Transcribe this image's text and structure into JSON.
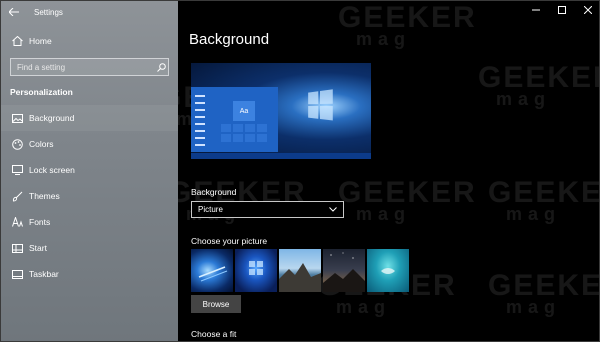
{
  "window": {
    "title": "Settings",
    "controls": [
      "minimize",
      "maximize",
      "close"
    ]
  },
  "sidebar": {
    "home_label": "Home",
    "search": {
      "placeholder": "Find a setting"
    },
    "section_title": "Personalization",
    "items": [
      {
        "label": "Background",
        "icon": "picture-icon",
        "active": true
      },
      {
        "label": "Colors",
        "icon": "palette-icon",
        "active": false
      },
      {
        "label": "Lock screen",
        "icon": "monitor-icon",
        "active": false
      },
      {
        "label": "Themes",
        "icon": "brush-icon",
        "active": false
      },
      {
        "label": "Fonts",
        "icon": "font-icon",
        "active": false
      },
      {
        "label": "Start",
        "icon": "start-grid-icon",
        "active": false
      },
      {
        "label": "Taskbar",
        "icon": "taskbar-icon",
        "active": false
      }
    ]
  },
  "main": {
    "page_title": "Background",
    "preview": {
      "tile_text": "Aa"
    },
    "background_label": "Background",
    "background_select": {
      "value": "Picture"
    },
    "choose_picture_label": "Choose your picture",
    "browse_label": "Browse",
    "choose_fit_label": "Choose a fit"
  },
  "watermark": {
    "line1": "GEEKER",
    "line2": "mag"
  },
  "colors": {
    "sidebar_bg": "#8a9095",
    "main_bg": "#000000",
    "accent": "#1f63c4"
  }
}
